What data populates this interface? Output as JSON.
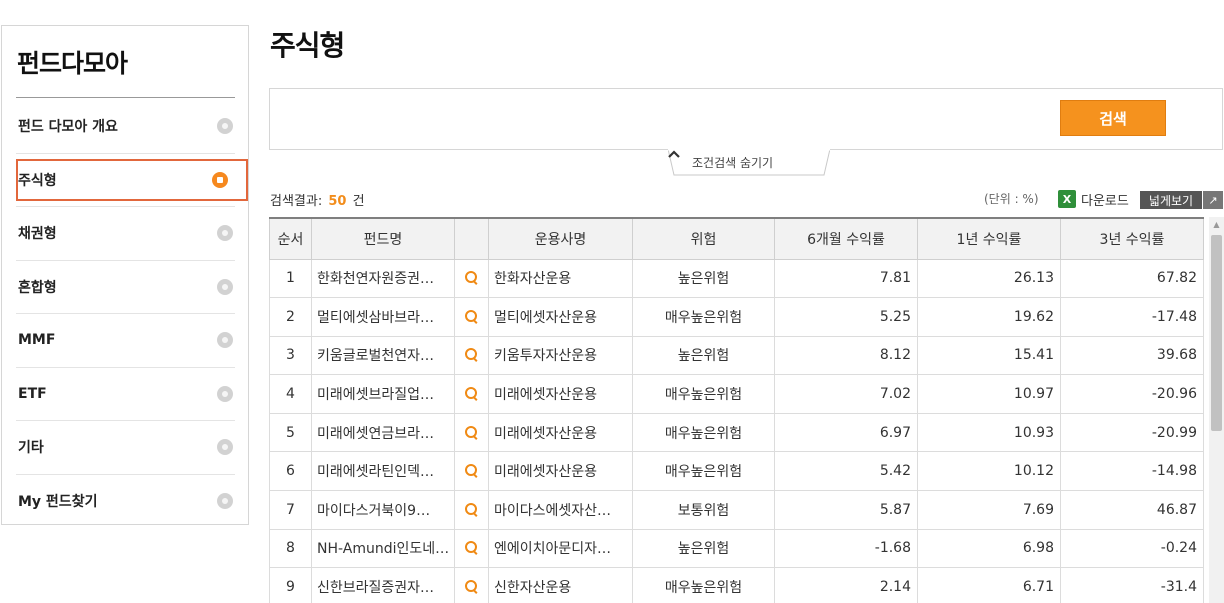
{
  "sidebar": {
    "title": "펀드다모아",
    "items": [
      {
        "label": "펀드 다모아 개요",
        "active": false
      },
      {
        "label": "주식형",
        "active": true
      },
      {
        "label": "채권형",
        "active": false
      },
      {
        "label": "혼합형",
        "active": false
      },
      {
        "label": "MMF",
        "active": false
      },
      {
        "label": "ETF",
        "active": false
      },
      {
        "label": "기타",
        "active": false
      },
      {
        "label": "My 펀드찾기",
        "active": false
      }
    ]
  },
  "main": {
    "title": "주식형",
    "search_button": "검색",
    "toggle_label": "조건검색 숨기기",
    "result_prefix": "검색결과:",
    "result_count": "50",
    "result_suffix": "건",
    "unit": "(단위 : %)",
    "excel_icon": "X",
    "download_label": "다운로드",
    "wide_view_label": "넓게보기",
    "accent_color": "#f5921e"
  },
  "table": {
    "headers": [
      "순서",
      "펀드명",
      "",
      "운용사명",
      "위험",
      "6개월 수익률",
      "1년 수익률",
      "3년 수익률"
    ],
    "rows": [
      {
        "no": "1",
        "name": "한화천연자원증권…",
        "company": "한화자산운용",
        "risk": "높은위험",
        "m6": "7.81",
        "y1": "26.13",
        "y3": "67.82"
      },
      {
        "no": "2",
        "name": "멀티에셋삼바브라…",
        "company": "멀티에셋자산운용",
        "risk": "매우높은위험",
        "m6": "5.25",
        "y1": "19.62",
        "y3": "-17.48"
      },
      {
        "no": "3",
        "name": "키움글로벌천연자…",
        "company": "키움투자자산운용",
        "risk": "높은위험",
        "m6": "8.12",
        "y1": "15.41",
        "y3": "39.68"
      },
      {
        "no": "4",
        "name": "미래에셋브라질업…",
        "company": "미래에셋자산운용",
        "risk": "매우높은위험",
        "m6": "7.02",
        "y1": "10.97",
        "y3": "-20.96"
      },
      {
        "no": "5",
        "name": "미래에셋연금브라…",
        "company": "미래에셋자산운용",
        "risk": "매우높은위험",
        "m6": "6.97",
        "y1": "10.93",
        "y3": "-20.99"
      },
      {
        "no": "6",
        "name": "미래에셋라틴인덱…",
        "company": "미래에셋자산운용",
        "risk": "매우높은위험",
        "m6": "5.42",
        "y1": "10.12",
        "y3": "-14.98"
      },
      {
        "no": "7",
        "name": "마이다스거북이9…",
        "company": "마이다스에셋자산…",
        "risk": "보통위험",
        "m6": "5.87",
        "y1": "7.69",
        "y3": "46.87"
      },
      {
        "no": "8",
        "name": "NH-Amundi인도네…",
        "company": "엔에이치아문디자…",
        "risk": "높은위험",
        "m6": "-1.68",
        "y1": "6.98",
        "y3": "-0.24"
      },
      {
        "no": "9",
        "name": "신한브라질증권자…",
        "company": "신한자산운용",
        "risk": "매우높은위험",
        "m6": "2.14",
        "y1": "6.71",
        "y3": "-31.4"
      }
    ]
  }
}
